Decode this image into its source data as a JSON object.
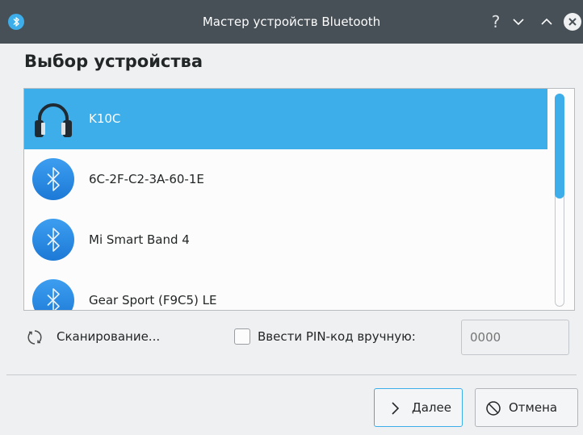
{
  "window": {
    "title": "Мастер устройств Bluetooth",
    "help_glyph": "?",
    "app_icon": "bluetooth-icon"
  },
  "heading": "Выбор устройства",
  "devices": [
    {
      "name": "K10C",
      "icon": "headphones-icon",
      "selected": true
    },
    {
      "name": "6C-2F-C2-3A-60-1E",
      "icon": "bluetooth-icon",
      "selected": false
    },
    {
      "name": "Mi Smart Band 4",
      "icon": "bluetooth-icon",
      "selected": false
    },
    {
      "name": "Gear Sport (F9C5) LE",
      "icon": "bluetooth-icon",
      "selected": false
    }
  ],
  "scan": {
    "label": "Сканирование..."
  },
  "pin": {
    "checkbox_label": "Ввести PIN-код вручную:",
    "placeholder": "0000",
    "checked": false
  },
  "buttons": {
    "next": "Далее",
    "cancel": "Отмена"
  },
  "colors": {
    "accent": "#3daee9",
    "titlebar": "#475057",
    "background": "#eff0f1"
  }
}
